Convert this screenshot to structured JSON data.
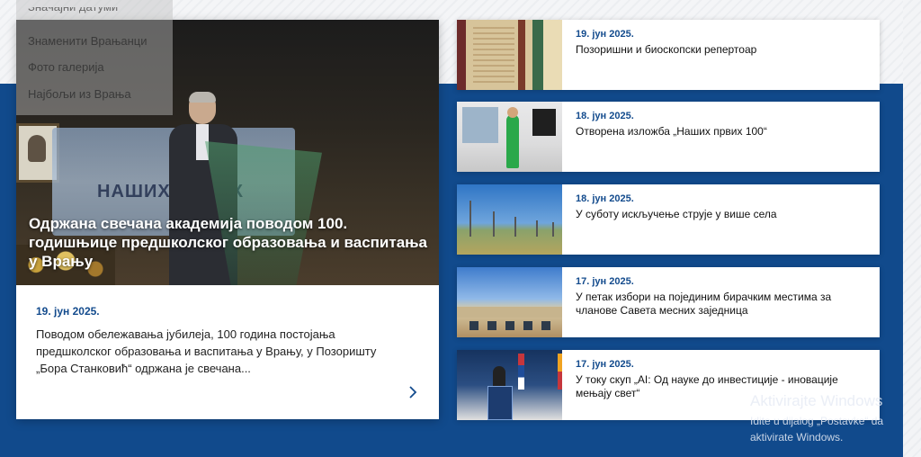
{
  "menu": {
    "items": [
      "Значајни датуми",
      "Знаменити Врањанци",
      "Фото галерија",
      "Најбољи из Врања"
    ]
  },
  "featured": {
    "title": "Одржана свечана академија поводом 100. годишњице предшколског образовања и васпитања у Врању",
    "date": "19. јун 2025.",
    "excerpt": "Поводом обележавања јубилеја, 100 година постојања предшколског образовања и васпитања у Врању, у Позоришту „Бора Станковић“ одржана је свечана...",
    "banner_text": "НАШИХ ПРВИХ",
    "more_icon": "chevron-right-icon"
  },
  "news": [
    {
      "date": "19. јун 2025.",
      "title": "Позоришни и биоскопски репертоар"
    },
    {
      "date": "18. јун 2025.",
      "title": "Отворена изложба „Наших првих 100“"
    },
    {
      "date": "18. јун 2025.",
      "title": "У суботу искључење струје у више села"
    },
    {
      "date": "17. јун 2025.",
      "title": "У петак избори на појединим бирачким местима за чланове Савета месних заједница"
    },
    {
      "date": "17. јун 2025.",
      "title": "У току скуп „AI: Од науке до инвестиције - иновације мењају свет“"
    }
  ],
  "watermark": {
    "title": "Aktivirajte Windows",
    "subtitle": "Idite u dijalog „Postavke“ da aktivirate Windows."
  },
  "colors": {
    "accent": "#134b8d",
    "band": "#114a8c"
  }
}
